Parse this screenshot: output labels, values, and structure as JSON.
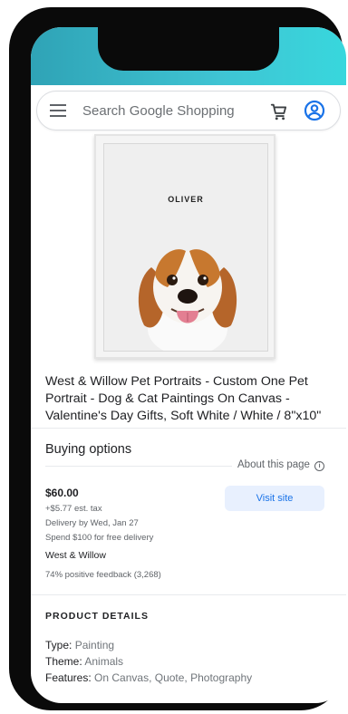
{
  "search": {
    "placeholder": "Search Google Shopping"
  },
  "icons": {
    "menu": "menu-icon",
    "cart": "shopping-cart-icon",
    "account": "account-circle-icon",
    "info": "info-icon"
  },
  "colors": {
    "accent_blue": "#1a73e8",
    "visit_button_bg": "#e8f0fe",
    "status_gradient_start": "#2fa3b6",
    "status_gradient_end": "#38d7dd"
  },
  "product": {
    "image_label": "OLIVER",
    "title": "West & Willow Pet Portraits - Custom One Pet Portrait - Dog & Cat Paintings On Canvas - Valentine's Day Gifts, Soft White / White / 8\"x10\""
  },
  "buying_options": {
    "heading": "Buying options",
    "about_page": "About this page",
    "info_glyph": "i",
    "offer": {
      "price": "$60.00",
      "tax": "+$5.77 est. tax",
      "delivery": "Delivery by Wed, Jan 27",
      "free_delivery": "Spend $100 for free delivery",
      "seller": "West & Willow",
      "feedback": "74% positive feedback (3,268)",
      "visit_label": "Visit site"
    }
  },
  "product_details": {
    "heading": "PRODUCT DETAILS",
    "rows": [
      {
        "label": "Type:",
        "value": "Painting"
      },
      {
        "label": "Theme:",
        "value": "Animals"
      },
      {
        "label": "Features:",
        "value": "On Canvas, Quote, Photography"
      }
    ]
  }
}
